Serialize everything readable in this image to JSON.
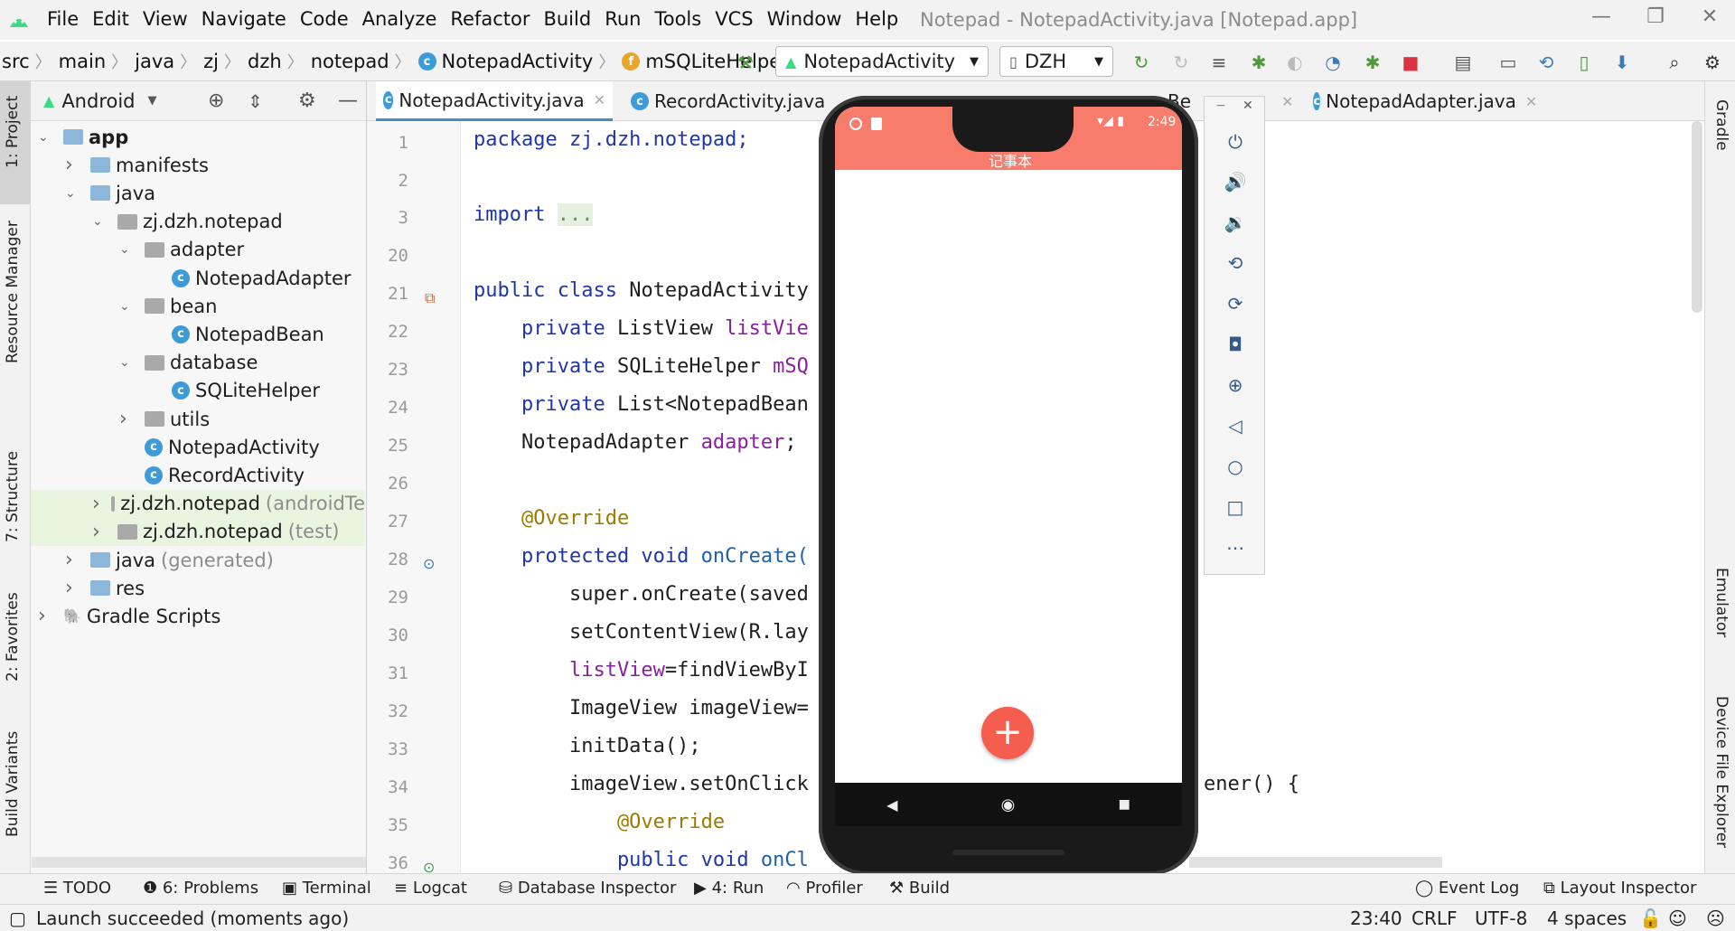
{
  "menubar": {
    "items": [
      "File",
      "Edit",
      "View",
      "Navigate",
      "Code",
      "Analyze",
      "Refactor",
      "Build",
      "Run",
      "Tools",
      "VCS",
      "Window",
      "Help"
    ],
    "window_title": "Notepad - NotepadActivity.java [Notepad.app]"
  },
  "navbar": {
    "breadcrumbs": [
      "src",
      "main",
      "java",
      "zj",
      "dzh",
      "notepad",
      "NotepadActivity",
      "mSQLiteHelper"
    ],
    "run_config": "NotepadActivity",
    "device": "DZH"
  },
  "side_tabs": {
    "left": [
      "1: Project",
      "Resource Manager",
      "7: Structure",
      "2: Favorites",
      "Build Variants"
    ],
    "right": [
      "Gradle",
      "Emulator",
      "Device File Explorer"
    ]
  },
  "project_panel": {
    "view_mode": "Android",
    "tree": [
      {
        "label": "app",
        "chevron": "v",
        "kind": "module"
      },
      {
        "label": "manifests",
        "chevron": ">",
        "kind": "folder"
      },
      {
        "label": "java",
        "chevron": "v",
        "kind": "folder"
      },
      {
        "label": "zj.dzh.notepad",
        "chevron": "v",
        "kind": "package"
      },
      {
        "label": "adapter",
        "chevron": "v",
        "kind": "package"
      },
      {
        "label": "NotepadAdapter",
        "chevron": "",
        "kind": "class"
      },
      {
        "label": "bean",
        "chevron": "v",
        "kind": "package"
      },
      {
        "label": "NotepadBean",
        "chevron": "",
        "kind": "class"
      },
      {
        "label": "database",
        "chevron": "v",
        "kind": "package"
      },
      {
        "label": "SQLiteHelper",
        "chevron": "",
        "kind": "class"
      },
      {
        "label": "utils",
        "chevron": ">",
        "kind": "package"
      },
      {
        "label": "NotepadActivity",
        "chevron": "",
        "kind": "class"
      },
      {
        "label": "RecordActivity",
        "chevron": "",
        "kind": "class"
      },
      {
        "label": "zj.dzh.notepad",
        "suffix": "(androidTe",
        "chevron": ">",
        "kind": "package"
      },
      {
        "label": "zj.dzh.notepad",
        "suffix": "(test)",
        "chevron": ">",
        "kind": "package"
      },
      {
        "label": "java",
        "suffix": "(generated)",
        "chevron": ">",
        "kind": "folder"
      },
      {
        "label": "res",
        "chevron": ">",
        "kind": "folder"
      },
      {
        "label": "Gradle Scripts",
        "chevron": ">",
        "kind": "gradle"
      }
    ]
  },
  "editor": {
    "tabs": [
      "NotepadActivity.java",
      "RecordActivity.java",
      "Be",
      "NotepadAdapter.java"
    ],
    "line_numbers": [
      "1",
      "2",
      "3",
      "20",
      "21",
      "22",
      "23",
      "24",
      "25",
      "26",
      "27",
      "28",
      "29",
      "30",
      "31",
      "32",
      "33",
      "34",
      "35",
      "36"
    ],
    "code": {
      "l1": "package zj.dzh.notepad;",
      "l3_kw": "import",
      "l3_fold": "...",
      "l21_a": "public class",
      "l21_b": " NotepadActivity",
      "l22_a": "    private",
      "l22_b": " ListView ",
      "l22_c": "listVie",
      "l23_a": "    private",
      "l23_b": " SQLiteHelper ",
      "l23_c": "mSQ",
      "l24_a": "    private",
      "l24_b": " List<NotepadBean",
      "l25_a": "    NotepadAdapter ",
      "l25_b": "adapter",
      "l25_c": ";",
      "l27": "    @Override",
      "l28_a": "    protected void",
      "l28_b": " onCreate(",
      "l29": "        super.onCreate(saved",
      "l30": "        setContentView(R.lay",
      "l31_a": "        listView",
      "l31_b": "=findViewByI",
      "l32": "        ImageView imageView=",
      "l33": "        initData();",
      "l34_a": "        imageView.setOnClick",
      "l34_b": "ener() {",
      "l35": "            @Override",
      "l36_a": "            public void",
      "l36_b": " onCl"
    }
  },
  "emulator": {
    "phone_time": "2:49",
    "app_title": "记事本",
    "fab": "+",
    "panel_icons": [
      "power-icon",
      "volume-up-icon",
      "volume-down-icon",
      "rotate-left-icon",
      "rotate-right-icon",
      "camera-icon",
      "zoom-icon",
      "back-icon",
      "home-icon",
      "overview-icon",
      "more-icon"
    ]
  },
  "bottom_tabs": [
    "TODO",
    "6: Problems",
    "Terminal",
    "Logcat",
    "Database Inspector",
    "4: Run",
    "Profiler",
    "Build",
    "Event Log",
    "Layout Inspector"
  ],
  "status": {
    "message": "Launch succeeded (moments ago)",
    "position": "23:40",
    "line_sep": "CRLF",
    "encoding": "UTF-8",
    "indent": "4 spaces"
  },
  "colors": {
    "accent": "#4a88c7",
    "app_bar": "#f87c6b",
    "fab": "#f55d4e"
  }
}
